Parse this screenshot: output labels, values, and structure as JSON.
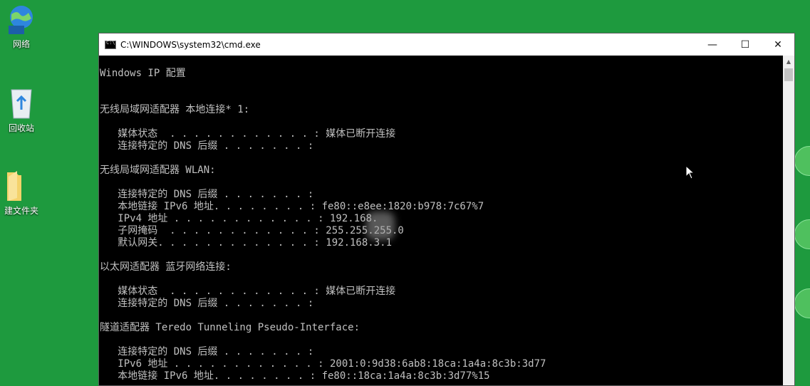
{
  "desktop": {
    "icons": [
      {
        "label": "网络"
      },
      {
        "label": "回收站"
      },
      {
        "label": "建文件夹"
      }
    ]
  },
  "window": {
    "title": "C:\\WINDOWS\\system32\\cmd.exe",
    "controls": {
      "minimize": "—",
      "maximize": "☐",
      "close": "✕"
    }
  },
  "console": {
    "lines": [
      "Windows IP 配置",
      "无线局域网适配器 本地连接* 1:",
      "   媒体状态  . . . . . . . . . . . . : 媒体已断开连接",
      "   连接特定的 DNS 后缀 . . . . . . . :",
      "无线局域网适配器 WLAN:",
      "   连接特定的 DNS 后缀 . . . . . . . :",
      "   本地链接 IPv6 地址. . . . . . . . : fe80::e8ee:1820:b978:7c67%7",
      "   IPv4 地址 . . . . . . . . . . . . : 192.168.",
      "   子网掩码  . . . . . . . . . . . . : 255.255.255.0",
      "   默认网关. . . . . . . . . . . . . : 192.168.3.1",
      "以太网适配器 蓝牙网络连接:",
      "   媒体状态  . . . . . . . . . . . . : 媒体已断开连接",
      "   连接特定的 DNS 后缀 . . . . . . . :",
      "隧道适配器 Teredo Tunneling Pseudo-Interface:",
      "   连接特定的 DNS 后缀 . . . . . . . :",
      "   IPv6 地址 . . . . . . . . . . . . : 2001:0:9d38:6ab8:18ca:1a4a:8c3b:3d77",
      "   本地链接 IPv6 地址. . . . . . . . : fe80::18ca:1a4a:8c3b:3d77%15"
    ]
  }
}
